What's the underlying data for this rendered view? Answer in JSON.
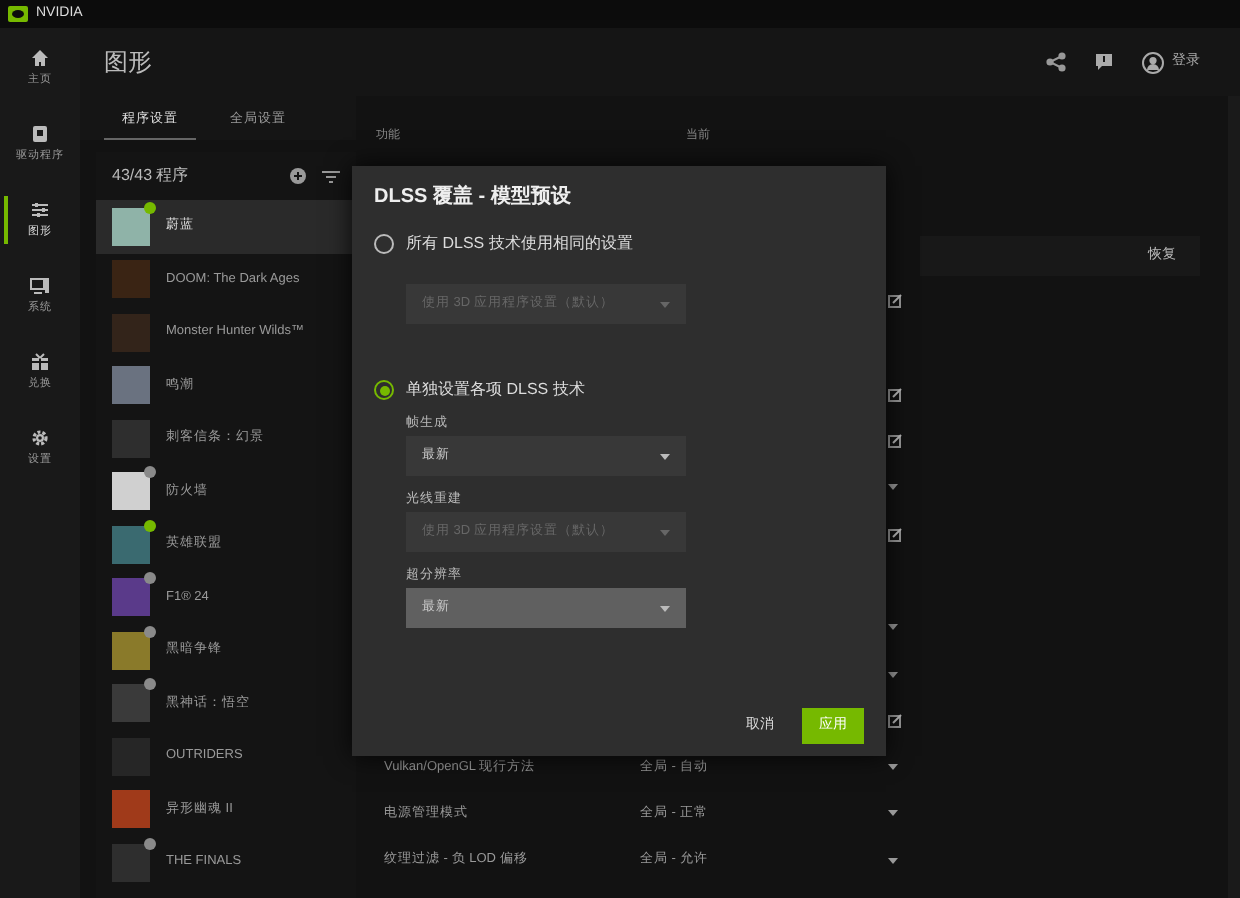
{
  "window": {
    "title": "NVIDIA"
  },
  "topbar": {
    "login": "登录"
  },
  "nav": [
    {
      "label": "主页",
      "selected": false
    },
    {
      "label": "驱动程序",
      "selected": false
    },
    {
      "label": "图形",
      "selected": true
    },
    {
      "label": "系统",
      "selected": false
    },
    {
      "label": "兑换",
      "selected": false
    },
    {
      "label": "设置",
      "selected": false
    }
  ],
  "page_title": "图形",
  "tabs": [
    {
      "label": "程序设置",
      "selected": true
    },
    {
      "label": "全局设置",
      "selected": false
    }
  ],
  "program_list": {
    "count": "43/43 程序",
    "items": [
      {
        "name": "蔚蓝",
        "selected": true,
        "color": "#76b900"
      },
      {
        "name": "DOOM: The Dark Ages",
        "selected": false
      },
      {
        "name": "Monster Hunter Wilds™",
        "selected": false
      },
      {
        "name": "鸣潮",
        "selected": false
      },
      {
        "name": "刺客信条：幻景",
        "selected": false
      },
      {
        "name": "防火墙",
        "selected": false,
        "color": "#8a8a8a"
      },
      {
        "name": "英雄联盟",
        "selected": false,
        "color": "#76b900"
      },
      {
        "name": "F1® 24",
        "selected": false,
        "color": "#8a8a8a"
      },
      {
        "name": "黑暗争锋",
        "selected": false,
        "color": "#8a8a8a"
      },
      {
        "name": "黑神话：悟空",
        "selected": false,
        "color": "#8a8a8a"
      },
      {
        "name": "OUTRIDERS",
        "selected": false
      },
      {
        "name": "异形幽魂 II",
        "selected": false
      },
      {
        "name": "THE FINALS",
        "selected": false,
        "color": "#8a8a8a"
      }
    ]
  },
  "settings": {
    "columns": [
      "功能",
      "当前"
    ],
    "restore_button": "恢复",
    "rows": [
      {
        "kind": "edit"
      },
      {
        "kind": "none"
      },
      {
        "kind": "edit"
      },
      {
        "kind": "edit"
      },
      {
        "kind": "chevron"
      },
      {
        "kind": "edit"
      },
      {
        "kind": "none"
      },
      {
        "kind": "chevron"
      },
      {
        "kind": "chevron"
      },
      {
        "kind": "edit"
      },
      {
        "kind": "chevron",
        "name": "Vulkan/OpenGL 现行方法",
        "value": "全局 - 自动"
      },
      {
        "kind": "chevron",
        "name": "电源管理模式",
        "value": "全局 - 正常"
      },
      {
        "kind": "chevron",
        "name": "纹理过滤 - 负 LOD 偏移",
        "value": "全局 - 允许"
      }
    ]
  },
  "dialog": {
    "title": "DLSS 覆盖 - 模型预设",
    "options": [
      {
        "label": "所有 DLSS 技术使用相同的设置",
        "selected": false,
        "fields": [
          {
            "value": "使用 3D 应用程序设置（默认）",
            "disabled": true,
            "highlighted": false
          }
        ]
      },
      {
        "label": "单独设置各项 DLSS 技术",
        "selected": true,
        "fields": [
          {
            "label": "帧生成",
            "value": "最新",
            "disabled": false,
            "highlighted": false
          },
          {
            "label": "光线重建",
            "value": "使用 3D 应用程序设置（默认）",
            "disabled": true,
            "highlighted": false
          },
          {
            "label": "超分辨率",
            "value": "最新",
            "disabled": false,
            "highlighted": true
          }
        ]
      }
    ],
    "cancel": "取消",
    "apply": "应用"
  }
}
